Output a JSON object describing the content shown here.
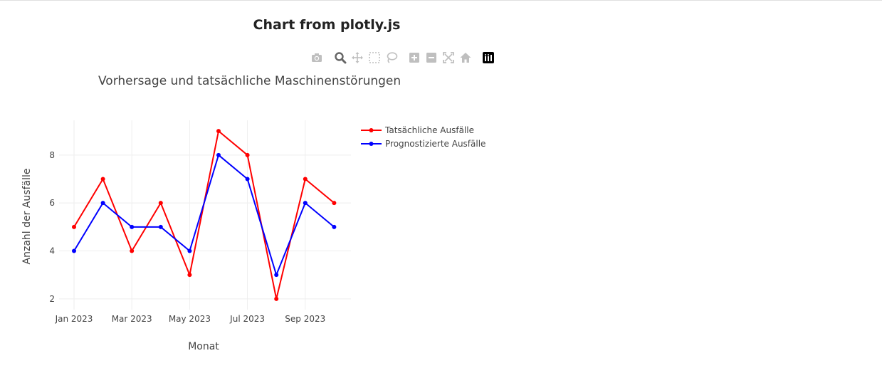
{
  "page": {
    "title": "Chart from plotly.js"
  },
  "modebar": {
    "buttons": [
      {
        "icon": "camera-icon",
        "label": "Download plot as a png"
      },
      {
        "icon": "zoom-icon",
        "label": "Zoom",
        "active": true
      },
      {
        "icon": "pan-icon",
        "label": "Pan"
      },
      {
        "icon": "box-select-icon",
        "label": "Box Select"
      },
      {
        "icon": "lasso-select-icon",
        "label": "Lasso Select"
      },
      {
        "icon": "zoom-in-icon",
        "label": "Zoom in"
      },
      {
        "icon": "zoom-out-icon",
        "label": "Zoom out"
      },
      {
        "icon": "autoscale-icon",
        "label": "Autoscale"
      },
      {
        "icon": "reset-axes-icon",
        "label": "Reset axes"
      },
      {
        "icon": "plotly-logo-icon",
        "label": "Produced with Plotly"
      }
    ]
  },
  "chart_data": {
    "type": "line",
    "title": "Vorhersage und tatsächliche Maschinenstörungen",
    "xlabel": "Monat",
    "ylabel": "Anzahl der Ausfälle",
    "x": [
      "2023-01",
      "2023-02",
      "2023-03",
      "2023-04",
      "2023-05",
      "2023-06",
      "2023-07",
      "2023-08",
      "2023-09",
      "2023-10"
    ],
    "x_tick_labels": [
      "Jan 2023",
      "Mar 2023",
      "May 2023",
      "Jul 2023",
      "Sep 2023"
    ],
    "y_ticks": [
      2,
      4,
      6,
      8
    ],
    "ylim": [
      1.55,
      9.45
    ],
    "grid": true,
    "legend_position": "top-right",
    "series": [
      {
        "name": "Tatsächliche Ausfälle",
        "color": "#ff0000",
        "values": [
          5,
          7,
          4,
          6,
          3,
          9,
          8,
          2,
          7,
          6
        ]
      },
      {
        "name": "Prognostizierte Ausfälle",
        "color": "#0000ff",
        "values": [
          4,
          6,
          5,
          5,
          4,
          8,
          7,
          3,
          6,
          5
        ]
      }
    ]
  }
}
